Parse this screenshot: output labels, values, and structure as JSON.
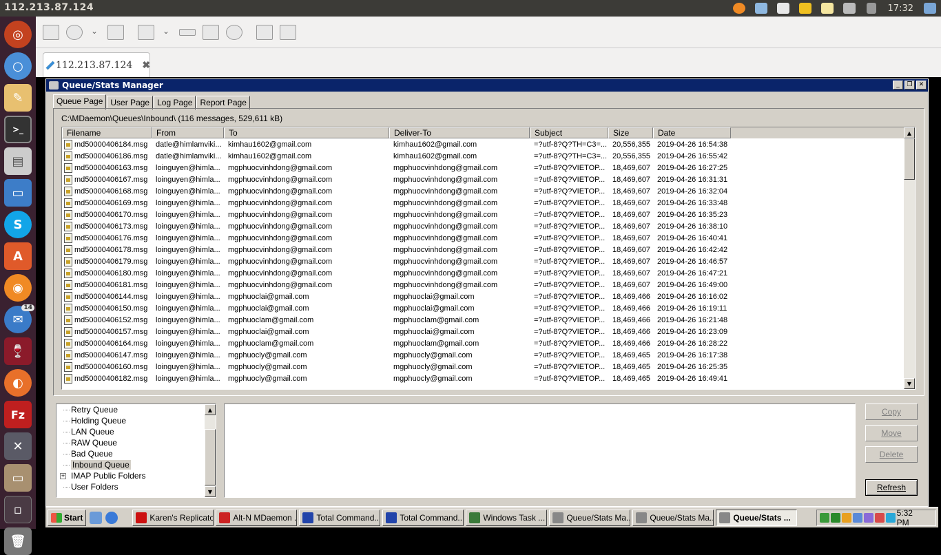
{
  "ubuntu_panel": {
    "title": "112.213.87.124",
    "clock": "17:32"
  },
  "remmina": {
    "tab_label": "112.213.87.124"
  },
  "dialog": {
    "title": "Queue/Stats Manager",
    "tabs": [
      "Queue Page",
      "User Page",
      "Log Page",
      "Report Page"
    ],
    "path_label": "C:\\MDaemon\\Queues\\Inbound\\  (116 messages, 529,611 kB)",
    "columns": [
      "Filename",
      "From",
      "To",
      "Deliver-To",
      "Subject",
      "Size",
      "Date"
    ],
    "rows": [
      [
        "md50000406184.msg",
        "datle@himlamviki...",
        "kimhau1602@gmail.com",
        "kimhau1602@gmail.com",
        "=?utf-8?Q?TH=C3=...",
        "20,556,355",
        "2019-04-26 16:54:38"
      ],
      [
        "md50000406186.msg",
        "datle@himlamviki...",
        "kimhau1602@gmail.com",
        "kimhau1602@gmail.com",
        "=?utf-8?Q?TH=C3=...",
        "20,556,355",
        "2019-04-26 16:55:42"
      ],
      [
        "md50000406163.msg",
        "loinguyen@himla...",
        "mgphuocvinhdong@gmail.com",
        "mgphuocvinhdong@gmail.com",
        "=?utf-8?Q?VIETOP...",
        "18,469,607",
        "2019-04-26 16:27:25"
      ],
      [
        "md50000406167.msg",
        "loinguyen@himla...",
        "mgphuocvinhdong@gmail.com",
        "mgphuocvinhdong@gmail.com",
        "=?utf-8?Q?VIETOP...",
        "18,469,607",
        "2019-04-26 16:31:31"
      ],
      [
        "md50000406168.msg",
        "loinguyen@himla...",
        "mgphuocvinhdong@gmail.com",
        "mgphuocvinhdong@gmail.com",
        "=?utf-8?Q?VIETOP...",
        "18,469,607",
        "2019-04-26 16:32:04"
      ],
      [
        "md50000406169.msg",
        "loinguyen@himla...",
        "mgphuocvinhdong@gmail.com",
        "mgphuocvinhdong@gmail.com",
        "=?utf-8?Q?VIETOP...",
        "18,469,607",
        "2019-04-26 16:33:48"
      ],
      [
        "md50000406170.msg",
        "loinguyen@himla...",
        "mgphuocvinhdong@gmail.com",
        "mgphuocvinhdong@gmail.com",
        "=?utf-8?Q?VIETOP...",
        "18,469,607",
        "2019-04-26 16:35:23"
      ],
      [
        "md50000406173.msg",
        "loinguyen@himla...",
        "mgphuocvinhdong@gmail.com",
        "mgphuocvinhdong@gmail.com",
        "=?utf-8?Q?VIETOP...",
        "18,469,607",
        "2019-04-26 16:38:10"
      ],
      [
        "md50000406176.msg",
        "loinguyen@himla...",
        "mgphuocvinhdong@gmail.com",
        "mgphuocvinhdong@gmail.com",
        "=?utf-8?Q?VIETOP...",
        "18,469,607",
        "2019-04-26 16:40:41"
      ],
      [
        "md50000406178.msg",
        "loinguyen@himla...",
        "mgphuocvinhdong@gmail.com",
        "mgphuocvinhdong@gmail.com",
        "=?utf-8?Q?VIETOP...",
        "18,469,607",
        "2019-04-26 16:42:42"
      ],
      [
        "md50000406179.msg",
        "loinguyen@himla...",
        "mgphuocvinhdong@gmail.com",
        "mgphuocvinhdong@gmail.com",
        "=?utf-8?Q?VIETOP...",
        "18,469,607",
        "2019-04-26 16:46:57"
      ],
      [
        "md50000406180.msg",
        "loinguyen@himla...",
        "mgphuocvinhdong@gmail.com",
        "mgphuocvinhdong@gmail.com",
        "=?utf-8?Q?VIETOP...",
        "18,469,607",
        "2019-04-26 16:47:21"
      ],
      [
        "md50000406181.msg",
        "loinguyen@himla...",
        "mgphuocvinhdong@gmail.com",
        "mgphuocvinhdong@gmail.com",
        "=?utf-8?Q?VIETOP...",
        "18,469,607",
        "2019-04-26 16:49:00"
      ],
      [
        "md50000406144.msg",
        "loinguyen@himla...",
        "mgphuoclai@gmail.com",
        "mgphuoclai@gmail.com",
        "=?utf-8?Q?VIETOP...",
        "18,469,466",
        "2019-04-26 16:16:02"
      ],
      [
        "md50000406150.msg",
        "loinguyen@himla...",
        "mgphuoclai@gmail.com",
        "mgphuoclai@gmail.com",
        "=?utf-8?Q?VIETOP...",
        "18,469,466",
        "2019-04-26 16:19:11"
      ],
      [
        "md50000406152.msg",
        "loinguyen@himla...",
        "mgphuoclam@gmail.com",
        "mgphuoclam@gmail.com",
        "=?utf-8?Q?VIETOP...",
        "18,469,466",
        "2019-04-26 16:21:48"
      ],
      [
        "md50000406157.msg",
        "loinguyen@himla...",
        "mgphuoclai@gmail.com",
        "mgphuoclai@gmail.com",
        "=?utf-8?Q?VIETOP...",
        "18,469,466",
        "2019-04-26 16:23:09"
      ],
      [
        "md50000406164.msg",
        "loinguyen@himla...",
        "mgphuoclam@gmail.com",
        "mgphuoclam@gmail.com",
        "=?utf-8?Q?VIETOP...",
        "18,469,466",
        "2019-04-26 16:28:22"
      ],
      [
        "md50000406147.msg",
        "loinguyen@himla...",
        "mgphuocly@gmail.com",
        "mgphuocly@gmail.com",
        "=?utf-8?Q?VIETOP...",
        "18,469,465",
        "2019-04-26 16:17:38"
      ],
      [
        "md50000406160.msg",
        "loinguyen@himla...",
        "mgphuocly@gmail.com",
        "mgphuocly@gmail.com",
        "=?utf-8?Q?VIETOP...",
        "18,469,465",
        "2019-04-26 16:25:35"
      ],
      [
        "md50000406182.msg",
        "loinguyen@himla...",
        "mgphuocly@gmail.com",
        "mgphuocly@gmail.com",
        "=?utf-8?Q?VIETOP...",
        "18,469,465",
        "2019-04-26 16:49:41"
      ]
    ],
    "queues": [
      {
        "label": "Retry Queue",
        "expandable": false,
        "selected": false
      },
      {
        "label": "Holding Queue",
        "expandable": false,
        "selected": false
      },
      {
        "label": "LAN Queue",
        "expandable": false,
        "selected": false
      },
      {
        "label": "RAW Queue",
        "expandable": false,
        "selected": false
      },
      {
        "label": "Bad Queue",
        "expandable": false,
        "selected": false
      },
      {
        "label": "Inbound Queue",
        "expandable": false,
        "selected": true
      },
      {
        "label": "IMAP Public Folders",
        "expandable": true,
        "selected": false
      },
      {
        "label": "User Folders",
        "expandable": false,
        "selected": false
      }
    ],
    "buttons": {
      "copy": "Copy",
      "move": "Move",
      "delete": "Delete",
      "refresh": "Refresh"
    }
  },
  "win_taskbar": {
    "start": "Start",
    "items": [
      {
        "label": "Karen's Replicator",
        "color": "#cc1111",
        "active": false
      },
      {
        "label": "Alt-N MDaemon ...",
        "color": "#cc2222",
        "active": false
      },
      {
        "label": "Total Command...",
        "color": "#2244aa",
        "active": false
      },
      {
        "label": "Total Command...",
        "color": "#2244aa",
        "active": false
      },
      {
        "label": "Windows Task ...",
        "color": "#3a7a3a",
        "active": false
      },
      {
        "label": "Queue/Stats Ma...",
        "color": "#888888",
        "active": false
      },
      {
        "label": "Queue/Stats Ma...",
        "color": "#888888",
        "active": false
      },
      {
        "label": "Queue/Stats ...",
        "color": "#888888",
        "active": true
      }
    ],
    "time": "5:32 PM"
  }
}
